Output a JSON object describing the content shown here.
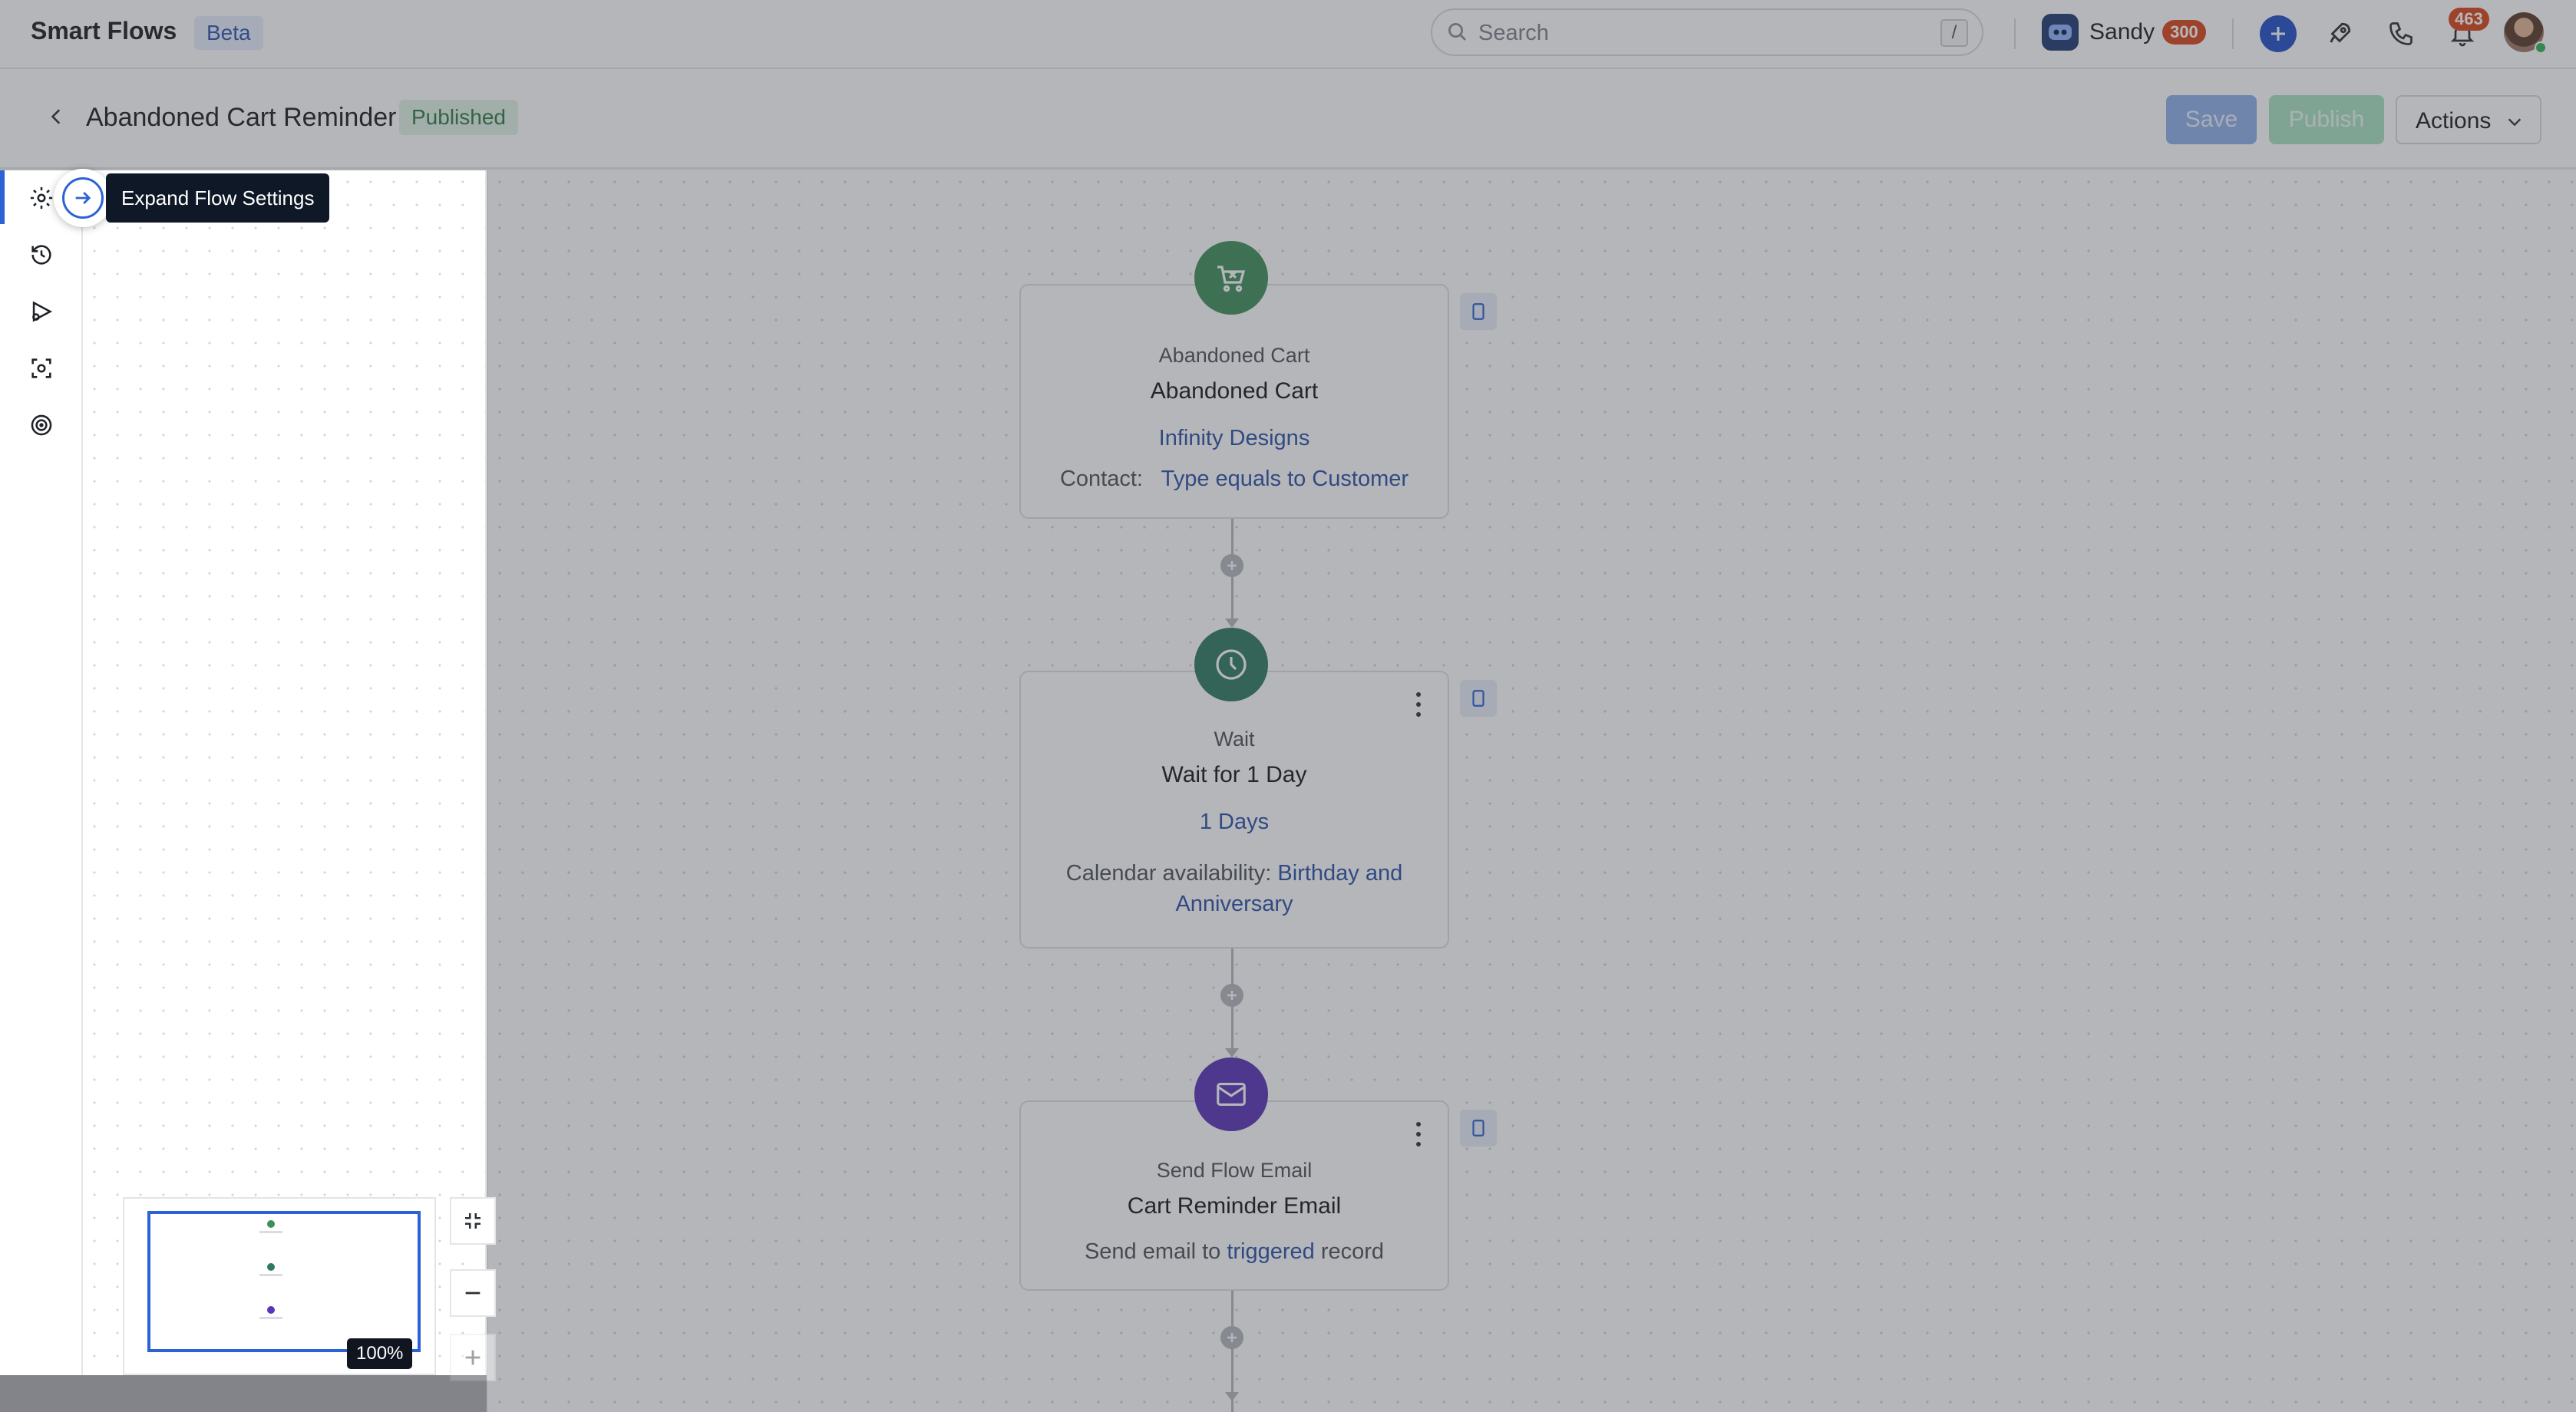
{
  "app": {
    "name": "Smart Flows",
    "badge": "Beta"
  },
  "search": {
    "placeholder": "Search",
    "shortcut": "/"
  },
  "user": {
    "name": "Sandy",
    "points": "300"
  },
  "notifications": {
    "count": "463"
  },
  "flow": {
    "title": "Abandoned Cart Reminder",
    "status": "Published",
    "save_label": "Save",
    "publish_label": "Publish",
    "actions_label": "Actions"
  },
  "rail": {
    "items": [
      "flow-settings",
      "history",
      "test-flow",
      "preview",
      "goals"
    ],
    "active": "flow-settings"
  },
  "tooltip": {
    "text": "Expand Flow Settings"
  },
  "zoom": {
    "level": "100%"
  },
  "nodes": [
    {
      "type": "Abandoned Cart",
      "title": "Abandoned Cart",
      "link": "Infinity Designs",
      "detail_label": "Contact:",
      "detail_value": "Type equals to Customer",
      "icon": "shopping-cart-icon",
      "color": "#3f8f5c"
    },
    {
      "type": "Wait",
      "title": "Wait for 1 Day",
      "link": "1 Days",
      "detail_label": "Calendar availability:",
      "detail_value_1": "Birthday and",
      "detail_value_2": "Anniversary",
      "icon": "clock-icon",
      "color": "#2f7a62"
    },
    {
      "type": "Send Flow Email",
      "title": "Cart Reminder Email",
      "detail_pre": "Send email to",
      "detail_value": "triggered",
      "detail_post": "record",
      "icon": "envelope-icon",
      "color": "#5a35b8"
    }
  ],
  "colors": {
    "accent": "#2d62d6",
    "published_bg": "#e1f3e6",
    "published_text": "#2f7a45",
    "badge_red": "#d9441a"
  }
}
